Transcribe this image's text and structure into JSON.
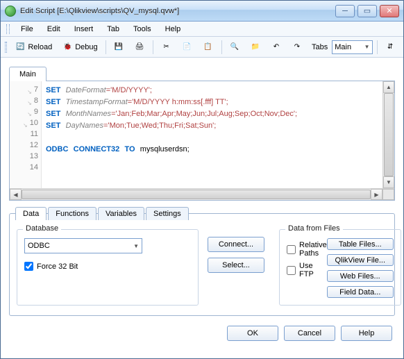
{
  "window": {
    "title": "Edit Script [E:\\Qlikview\\scripts\\QV_mysql.qvw*]"
  },
  "menu": {
    "file": "File",
    "edit": "Edit",
    "insert": "Insert",
    "tab": "Tab",
    "tools": "Tools",
    "help": "Help"
  },
  "toolbar": {
    "reload": "Reload",
    "debug": "Debug",
    "tabs_label": "Tabs",
    "tabs_value": "Main"
  },
  "script_tab": {
    "main": "Main"
  },
  "code_lines": [
    {
      "n": 7,
      "kw": "SET",
      "id": "DateFormat",
      "rest": "='M/D/YYYY';"
    },
    {
      "n": 8,
      "kw": "SET",
      "id": "TimestampFormat",
      "rest": "='M/D/YYYY h:mm:ss[.fff] TT';"
    },
    {
      "n": 9,
      "kw": "SET",
      "id": "MonthNames",
      "rest": "='Jan;Feb;Mar;Apr;May;Jun;Jul;Aug;Sep;Oct;Nov;Dec';"
    },
    {
      "n": 10,
      "kw": "SET",
      "id": "DayNames",
      "rest": "='Mon;Tue;Wed;Thu;Fri;Sat;Sun';"
    },
    {
      "n": 11,
      "kw": "",
      "id": "",
      "rest": ""
    },
    {
      "n": 12,
      "kw": "ODBC",
      "kw2": "CONNECT32",
      "kw3": "TO",
      "id": "mysqluserdsn",
      "rest": ";"
    },
    {
      "n": 13,
      "kw": "",
      "id": "",
      "rest": ""
    },
    {
      "n": 14,
      "kw": "",
      "id": "",
      "rest": ""
    }
  ],
  "bottom_tabs": {
    "data": "Data",
    "functions": "Functions",
    "variables": "Variables",
    "settings": "Settings"
  },
  "database": {
    "legend": "Database",
    "driver": "ODBC",
    "force32": "Force 32 Bit",
    "force32_checked": true,
    "connect": "Connect...",
    "select": "Select..."
  },
  "files": {
    "legend": "Data from Files",
    "relative": "Relative Paths",
    "useftp": "Use FTP",
    "table_files": "Table Files...",
    "qlikview_file": "QlikView File...",
    "web_files": "Web Files...",
    "field_data": "Field Data..."
  },
  "dialog": {
    "ok": "OK",
    "cancel": "Cancel",
    "help": "Help"
  }
}
